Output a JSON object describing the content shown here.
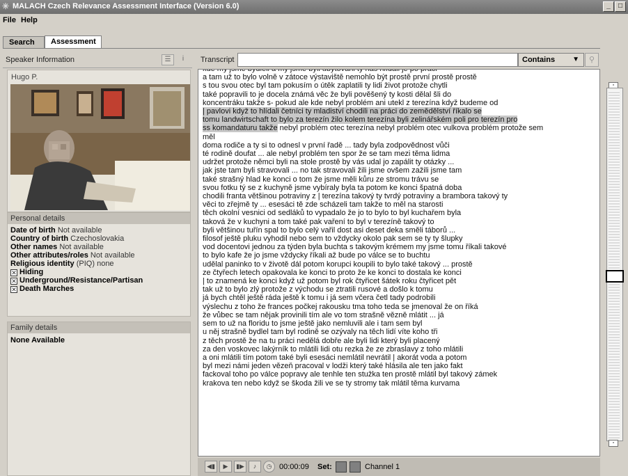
{
  "window": {
    "title": "MALACH Czech Relevance Assessment Interface (Version 6.0)",
    "minimize": "_",
    "maximize": "□"
  },
  "menu": [
    "File",
    "Help"
  ],
  "tabs": [
    {
      "label": "Search",
      "active": false
    },
    {
      "label": "Assessment",
      "active": true
    }
  ],
  "speaker": {
    "header": "Speaker Information",
    "name": "Hugo P."
  },
  "personal": {
    "header": "Personal details",
    "fields": [
      {
        "label": "Date of birth",
        "value": "Not available"
      },
      {
        "label": "Country of birth",
        "value": "Czechoslovakia"
      },
      {
        "label": "Other names",
        "value": "Not available"
      },
      {
        "label": "Other attributes/roles",
        "value": "Not available"
      },
      {
        "label": "Religious identity",
        "value": "(PIQ) none"
      }
    ],
    "checkboxes": [
      {
        "label": "Hiding",
        "checked": true
      },
      {
        "label": "Underground/Resistance/Partisan",
        "checked": true
      },
      {
        "label": "Death Marches",
        "checked": true
      }
    ]
  },
  "family": {
    "header": "Family details",
    "value": "None Available"
  },
  "transcript": {
    "label": "Transcript",
    "search_value": "",
    "match_mode": "Contains",
    "lines": [
      {
        "text": "kde my jsme bydleli a my jsme byli ubytovani ty nás hlídali je po práci",
        "hl": false
      },
      {
        "text": "a tam už to bylo volně v zátoce výstaviště nemohlo být prostě první prostě prostě",
        "hl": false
      },
      {
        "text": "s tou svou otec byl tam pokusím o útěk zaplatili ty lidi život protože chytli",
        "hl": false
      },
      {
        "text": "také popravili to je docela známá věc že byli pověšený ty kosti dělal šli do",
        "hl": false
      },
      {
        "text": "koncentráku takže s- pokud ale kde nebyl problém ani utekl z terezína když budeme od",
        "hl": false
      },
      {
        "text": "| pavlovi když to hlídali četníci ty mladiství chodili na práci do zemědělství říkalo se",
        "hl": true
      },
      {
        "text": "tomu landwirtschaft to bylo za terezín žilo kolem terezína byli zelinářském poli pro terezín pro",
        "hl": true
      },
      {
        "text": "ss komandaturu takže",
        "tail": " nebyl problém otec terezína nebyl problém otec vulkova problém protože sem",
        "hl": "partial"
      },
      {
        "text": "měl",
        "hl": false
      },
      {
        "text": "doma rodiče a ty si to odnesl v první řadě ... tady byla zodpovědnost vůči",
        "hl": false
      },
      {
        "text": "té rodině doufat ... ale nebyl problém ten spor že se tam mezi těma lidma",
        "hl": false
      },
      {
        "text": "udržet protože němci byli na stole prostě by vás udal jo zapálit ty otázky ...",
        "hl": false
      },
      {
        "text": "jak jste tam byli stravovali ... no tak stravovali žili jsme ovšem zažili jsme tam",
        "hl": false
      },
      {
        "text": "také strašný hlad ke konci o tom že jsme měli kůru ze stromu trávu se",
        "hl": false
      },
      {
        "text": "svou fotku tý se z kuchyně jsme vybíraly byla ta potom ke konci špatná doba",
        "hl": false
      },
      {
        "text": "chodili franta většinou potraviny z | terezína takový ty tvrdý potraviny a brambora takový ty",
        "hl": false
      },
      {
        "text": "věci to zřejmě ty ... esesáci tě zde scházeli tam takže to měl na starosti",
        "hl": false
      },
      {
        "text": "těch okolní vesnici od sedláků to vypadalo že jo to bylo to byl kuchařem byla",
        "hl": false
      },
      {
        "text": "taková že v kuchyni a tom také pak vaření to byl v terezíně takový to",
        "hl": false
      },
      {
        "text": "byli většinou tuřín spal to bylo celý vařil dost asi deset deka směli táborů ...",
        "hl": false
      },
      {
        "text": "filosof ještě pluku vyhodil nebo sem to vždycky okolo pak sem se ty ty šlupky",
        "hl": false
      },
      {
        "text": "vod docentovi jednou za týden byla buchta s takovým krémem my jsme tomu říkali takové",
        "hl": false
      },
      {
        "text": "to bylo kafe že jo jsme vždycky říkali až bude po válce se to buchtu",
        "hl": false
      },
      {
        "text": "udělal paninko to v životě dál potom korupci koupili to bylo také takový ... prostě",
        "hl": false
      },
      {
        "text": "ze čtyřech letech opakovala ke konci to proto že ke konci to dostala ke konci",
        "hl": false
      },
      {
        "text": "| to znamená ke konci když už potom byl rok čtyřicet šátek roku čtyřicet pět",
        "hl": false
      },
      {
        "text": "tak už to bylo zlý protože z východu se ztratili rusové a došlo k tomu",
        "hl": false
      },
      {
        "text": "já bych chtěl ještě ráda ještě k tomu i já sem včera četl tady podrobili",
        "hl": false
      },
      {
        "text": "výslechu z toho že frances počkej rakousku tma toho teda se jmenoval že on říká",
        "hl": false
      },
      {
        "text": "že vůbec se tam nějak provinili tím ale vo tom strašně vězně mlátit ... já",
        "hl": false
      },
      {
        "text": "sem to už na floridu to jsme ještě jako nemluvili ale i tam sem byl",
        "hl": false
      },
      {
        "text": "u něj strašně bydlel tam byl rodině se ozývaly na těch lidí víte koho tři",
        "hl": false
      },
      {
        "text": "z těch prostě že na tu práci nedělá dobře ale byli lidi který byli placený",
        "hl": false
      },
      {
        "text": "za den voskovec lakýrník to mlátili lidi otu rezka že ze zbraslavy z toho mlátili",
        "hl": false
      },
      {
        "text": "a oni mlátili tím potom také byli esesáci nemlátil nevrátil | akorát voda a potom",
        "hl": false
      },
      {
        "text": "byl mezi námi jeden vězeň pracoval v lodži který také hlásila ale ten jako fakt",
        "hl": false
      },
      {
        "text": "fackoval toho po válce popravy ale tenhle ten stužka ten prostě mlátil byl takový zámek",
        "hl": false
      },
      {
        "text": "krakova ten nebo když se škoda žili ve se ty stromy tak mlátil těma kurvama",
        "hl": false
      }
    ]
  },
  "player": {
    "time": "00:00:09",
    "set_label": "Set:",
    "channel": "Channel 1"
  },
  "colors": {
    "titlebar": "#7c7c7c",
    "background": "#d4d0c8",
    "highlight": "#c8c8c8"
  }
}
